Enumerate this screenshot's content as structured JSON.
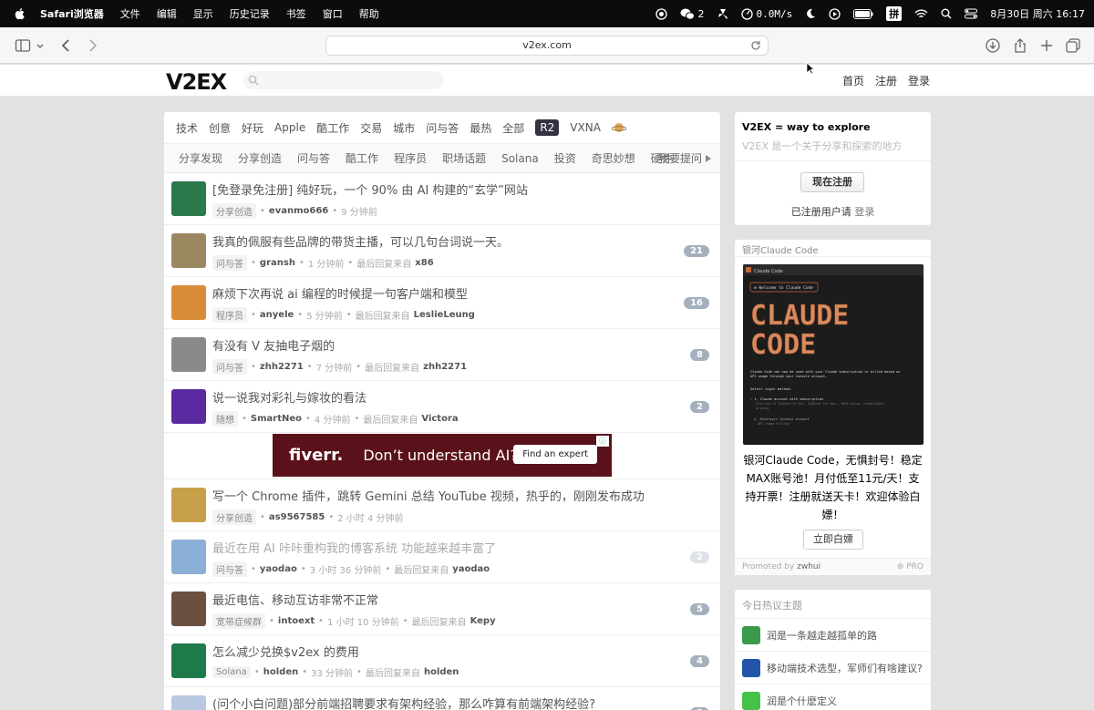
{
  "menubar": {
    "app": "Safari浏览器",
    "items": [
      "文件",
      "编辑",
      "显示",
      "历史记录",
      "书签",
      "窗口",
      "帮助"
    ],
    "status": {
      "wechat_count": "2",
      "net_speed": "0.0M/s",
      "ime": "拼",
      "datetime": "8月30日 周六 16:17"
    }
  },
  "browser": {
    "url": "v2ex.com"
  },
  "site": {
    "logo": "V2EX",
    "nav": [
      "首页",
      "注册",
      "登录"
    ]
  },
  "tabs": [
    "技术",
    "创意",
    "好玩",
    "Apple",
    "酷工作",
    "交易",
    "城市",
    "问与答",
    "最热",
    "全部",
    "R2",
    "VXNA"
  ],
  "active_tab": "R2",
  "subtabs": [
    "分享发现",
    "分享创造",
    "问与答",
    "酷工作",
    "程序员",
    "职场话题",
    "Solana",
    "投资",
    "奇思妙想",
    "硬件"
  ],
  "subtab_more": "我要提问",
  "topics": [
    {
      "title": "[免登录免注册] 纯好玩，一个 90% 由 AI 构建的“玄学”网站",
      "node": "分享创造",
      "author": "evanmo666",
      "time": "9 分钟前",
      "last_reply_label": "",
      "last_reply": "",
      "count": "",
      "avatar": "#2c7a4b"
    },
    {
      "title": "我真的佩服有些品牌的带货主播，可以几句台词说一天。",
      "node": "问与答",
      "author": "gransh",
      "time": "1 分钟前",
      "last_reply_label": "最后回复来自",
      "last_reply": "x86",
      "count": "21",
      "avatar": "#9c8860"
    },
    {
      "title": "麻烦下次再说 ai 编程的时候提一句客户端和模型",
      "node": "程序员",
      "author": "anyele",
      "time": "5 分钟前",
      "last_reply_label": "最后回复来自",
      "last_reply": "LeslieLeung",
      "count": "16",
      "avatar": "#d88c3a"
    },
    {
      "title": "有没有 V 友抽电子烟的",
      "node": "问与答",
      "author": "zhh2271",
      "time": "7 分钟前",
      "last_reply_label": "最后回复来自",
      "last_reply": "zhh2271",
      "count": "8",
      "avatar": "#8a8a8a"
    },
    {
      "title": "说一说我对彩礼与嫁妆的看法",
      "node": "随想",
      "author": "SmartNeo",
      "time": "4 分钟前",
      "last_reply_label": "最后回复来自",
      "last_reply": "Victora",
      "count": "2",
      "avatar": "#5b2aa0"
    }
  ],
  "ad": {
    "brand": "fiverr.",
    "message": "Don’t understand AI?",
    "cta": "Find an expert"
  },
  "topics2": [
    {
      "title": "写一个 Chrome 插件，跳转 Gemini 总结 YouTube 视频，热乎的，刚刚发布成功",
      "node": "分享创造",
      "author": "as9567585",
      "time": "2 小时 4 分钟前",
      "last_reply_label": "",
      "last_reply": "",
      "count": "",
      "avatar": "#c9a04a"
    },
    {
      "title": "最近在用 AI 咔咔重构我的博客系统 功能越来越丰富了",
      "node": "问与答",
      "author": "yaodao",
      "time": "3 小时 36 分钟前",
      "last_reply_label": "最后回复来自",
      "last_reply": "yaodao",
      "count": "2",
      "avatar": "#8ab0d8",
      "faded": true
    },
    {
      "title": "最近电信、移动互访非常不正常",
      "node": "宽带症候群",
      "author": "intoext",
      "time": "1 小时 10 分钟前",
      "last_reply_label": "最后回复来自",
      "last_reply": "Kepy",
      "count": "5",
      "avatar": "#6b5040"
    },
    {
      "title": "怎么减少兑换$v2ex 的费用",
      "node": "Solana",
      "author": "holden",
      "time": "33 分钟前",
      "last_reply_label": "最后回复来自",
      "last_reply": "holden",
      "count": "4",
      "avatar": "#1f7a4a"
    },
    {
      "title": "(问个小白问题)部分前端招聘要求有架构经验，那么咋算有前端架构经验?",
      "node": "",
      "author": "",
      "time": "",
      "last_reply_label": "",
      "last_reply": "",
      "count": "3",
      "avatar": "#b8c8e0"
    }
  ],
  "sidebar": {
    "welcome_title": "V2EX = way to explore",
    "welcome_sub": "V2EX 是一个关于分享和探索的地方",
    "register_button": "现在注册",
    "login_prefix": "已注册用户请",
    "login_link": "登录",
    "promo_header": "银河Claude Code",
    "promo_text": "银河Claude Code，无惧封号！稳定MAX账号池！月付低至11元/天！支持开票！注册就送天卡！欢迎体验白嫖！",
    "promo_button": "立即白嫖",
    "promo_footer_prefix": "Promoted by",
    "promo_footer_user": "zwhui",
    "promo_footer_pro": "PRO",
    "shot": {
      "tab": "Claude Code",
      "welcome": "✻ Welcome to Claude Code",
      "big1": "CLAUDE",
      "big2": "CODE",
      "line1": "Claude Code can now be used with your Claude subscription or billed based on",
      "line2": "API usage through your Console account.",
      "select": "Select login method:",
      "opt1": "› 1. Claude account with subscription",
      "opt1b": "Starting at $20/mo for Pro, $100/mo for Max - Best value, predictable",
      "opt1c": "pricing",
      "opt2": "2. Anthropic Console account",
      "opt2b": "API usage billing"
    },
    "hot_header": "今日热议主题",
    "hot": [
      {
        "title": "润是一条越走越孤单的路",
        "color": "#3a9a4a"
      },
      {
        "title": "移动端技术选型，军师们有啥建议?",
        "color": "#2255aa"
      },
      {
        "title": "润是个什麽定义",
        "color": "#46c24a"
      }
    ]
  }
}
